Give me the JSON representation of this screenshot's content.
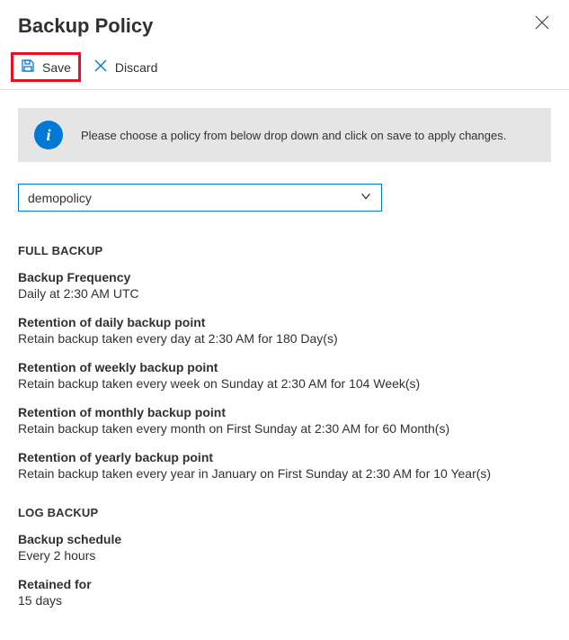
{
  "panel": {
    "title": "Backup Policy"
  },
  "toolbar": {
    "save_label": "Save",
    "discard_label": "Discard"
  },
  "info": {
    "message": "Please choose a policy from below drop down and click on save to apply changes.",
    "icon_glyph": "i"
  },
  "policy_select": {
    "value": "demopolicy"
  },
  "full_backup": {
    "section_title": "FULL BACKUP",
    "frequency": {
      "label": "Backup Frequency",
      "value": "Daily at 2:30 AM UTC"
    },
    "retention_daily": {
      "label": "Retention of daily backup point",
      "value": "Retain backup taken every day at 2:30 AM for 180 Day(s)"
    },
    "retention_weekly": {
      "label": "Retention of weekly backup point",
      "value": "Retain backup taken every week on Sunday at 2:30 AM for 104 Week(s)"
    },
    "retention_monthly": {
      "label": "Retention of monthly backup point",
      "value": "Retain backup taken every month on First Sunday at 2:30 AM for 60 Month(s)"
    },
    "retention_yearly": {
      "label": "Retention of yearly backup point",
      "value": "Retain backup taken every year in January on First Sunday at 2:30 AM for 10 Year(s)"
    }
  },
  "log_backup": {
    "section_title": "LOG BACKUP",
    "schedule": {
      "label": "Backup schedule",
      "value": "Every 2 hours"
    },
    "retained": {
      "label": "Retained for",
      "value": "15 days"
    }
  }
}
